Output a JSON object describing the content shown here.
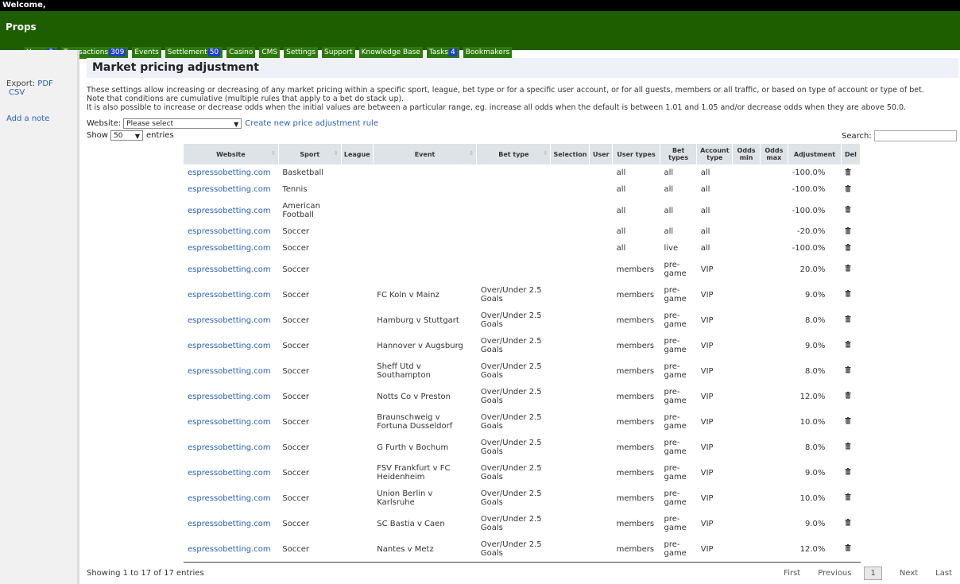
{
  "topbar": {
    "welcome": "Welcome,"
  },
  "brand": "Props",
  "nav": [
    {
      "label": "Users",
      "badge": "3"
    },
    {
      "label": "Transactions",
      "badge": "309"
    },
    {
      "label": "Events",
      "badge": null
    },
    {
      "label": "Settlement",
      "badge": "50"
    },
    {
      "label": "Casino",
      "badge": null
    },
    {
      "label": "CMS",
      "badge": null
    },
    {
      "label": "Settings",
      "badge": null
    },
    {
      "label": "Support",
      "badge": null
    },
    {
      "label": "Knowledge Base",
      "badge": null
    },
    {
      "label": "Tasks",
      "badge": "4"
    },
    {
      "label": "Bookmakers",
      "badge": null
    }
  ],
  "sidebar": {
    "export_label": "Export:",
    "pdf": "PDF",
    "csv": "CSV",
    "add_note": "Add a note"
  },
  "page": {
    "title": "Market pricing adjustment",
    "desc1": "These settings allow increasing or decreasing of any market pricing within a specific sport, league, bet type or for a specific user account, or for all guests, members or all traffic, or based on type of account or type of bet.",
    "desc2": "Note that conditions are cumulative (multiple rules that apply to a bet do stack up).",
    "desc3": "It is also possible to increase or decrease odds when the initial values are between a particular range, eg. increase all odds when the default is between 1.01 and 1.05 and/or decrease odds when they are above 50.0.",
    "website_label": "Website:",
    "website_select": "Please select",
    "create_link": "Create new price adjustment rule",
    "show_label": "Show",
    "show_value": "50",
    "entries_label": "entries",
    "search_label": "Search:"
  },
  "table": {
    "headers": [
      "Website",
      "Sport",
      "League",
      "Event",
      "Bet type",
      "Selection",
      "User",
      "User types",
      "Bet types",
      "Account type",
      "Odds min",
      "Odds max",
      "Adjustment",
      "Del"
    ],
    "rows": [
      [
        "espressobetting.com",
        "Basketball",
        "",
        "",
        "",
        "",
        "",
        "all",
        "all",
        "all",
        "",
        "",
        "-100.0%"
      ],
      [
        "espressobetting.com",
        "Tennis",
        "",
        "",
        "",
        "",
        "",
        "all",
        "all",
        "all",
        "",
        "",
        "-100.0%"
      ],
      [
        "espressobetting.com",
        "American Football",
        "",
        "",
        "",
        "",
        "",
        "all",
        "all",
        "all",
        "",
        "",
        "-100.0%"
      ],
      [
        "espressobetting.com",
        "Soccer",
        "",
        "",
        "",
        "",
        "",
        "all",
        "all",
        "all",
        "",
        "",
        "-20.0%"
      ],
      [
        "espressobetting.com",
        "Soccer",
        "",
        "",
        "",
        "",
        "",
        "all",
        "live",
        "all",
        "",
        "",
        "-100.0%"
      ],
      [
        "espressobetting.com",
        "Soccer",
        "",
        "",
        "",
        "",
        "",
        "members",
        "pre-game",
        "VIP",
        "",
        "",
        "20.0%"
      ],
      [
        "espressobetting.com",
        "Soccer",
        "",
        "FC Koln v Mainz",
        "Over/Under 2.5 Goals",
        "",
        "",
        "members",
        "pre-game",
        "VIP",
        "",
        "",
        "9.0%"
      ],
      [
        "espressobetting.com",
        "Soccer",
        "",
        "Hamburg v Stuttgart",
        "Over/Under 2.5 Goals",
        "",
        "",
        "members",
        "pre-game",
        "VIP",
        "",
        "",
        "8.0%"
      ],
      [
        "espressobetting.com",
        "Soccer",
        "",
        "Hannover v Augsburg",
        "Over/Under 2.5 Goals",
        "",
        "",
        "members",
        "pre-game",
        "VIP",
        "",
        "",
        "9.0%"
      ],
      [
        "espressobetting.com",
        "Soccer",
        "",
        "Sheff Utd v Southampton",
        "Over/Under 2.5 Goals",
        "",
        "",
        "members",
        "pre-game",
        "VIP",
        "",
        "",
        "8.0%"
      ],
      [
        "espressobetting.com",
        "Soccer",
        "",
        "Notts Co v Preston",
        "Over/Under 2.5 Goals",
        "",
        "",
        "members",
        "pre-game",
        "VIP",
        "",
        "",
        "12.0%"
      ],
      [
        "espressobetting.com",
        "Soccer",
        "",
        "Braunschweig v Fortuna Dusseldorf",
        "Over/Under 2.5 Goals",
        "",
        "",
        "members",
        "pre-game",
        "VIP",
        "",
        "",
        "10.0%"
      ],
      [
        "espressobetting.com",
        "Soccer",
        "",
        "G Furth v Bochum",
        "Over/Under 2.5 Goals",
        "",
        "",
        "members",
        "pre-game",
        "VIP",
        "",
        "",
        "8.0%"
      ],
      [
        "espressobetting.com",
        "Soccer",
        "",
        "FSV Frankfurt v FC Heidenheim",
        "Over/Under 2.5 Goals",
        "",
        "",
        "members",
        "pre-game",
        "VIP",
        "",
        "",
        "9.0%"
      ],
      [
        "espressobetting.com",
        "Soccer",
        "",
        "Union Berlin v Karlsruhe",
        "Over/Under 2.5 Goals",
        "",
        "",
        "members",
        "pre-game",
        "VIP",
        "",
        "",
        "10.0%"
      ],
      [
        "espressobetting.com",
        "Soccer",
        "",
        "SC Bastia v Caen",
        "Over/Under 2.5 Goals",
        "",
        "",
        "members",
        "pre-game",
        "VIP",
        "",
        "",
        "9.0%"
      ],
      [
        "espressobetting.com",
        "Soccer",
        "",
        "Nantes v Metz",
        "Over/Under 2.5 Goals",
        "",
        "",
        "members",
        "pre-game",
        "VIP",
        "",
        "",
        "12.0%"
      ]
    ],
    "delete_icon": "trash-icon"
  },
  "footer": {
    "info": "Showing 1 to 17 of 17 entries",
    "first": "First",
    "previous": "Previous",
    "current": "1",
    "next": "Next",
    "last": "Last"
  }
}
